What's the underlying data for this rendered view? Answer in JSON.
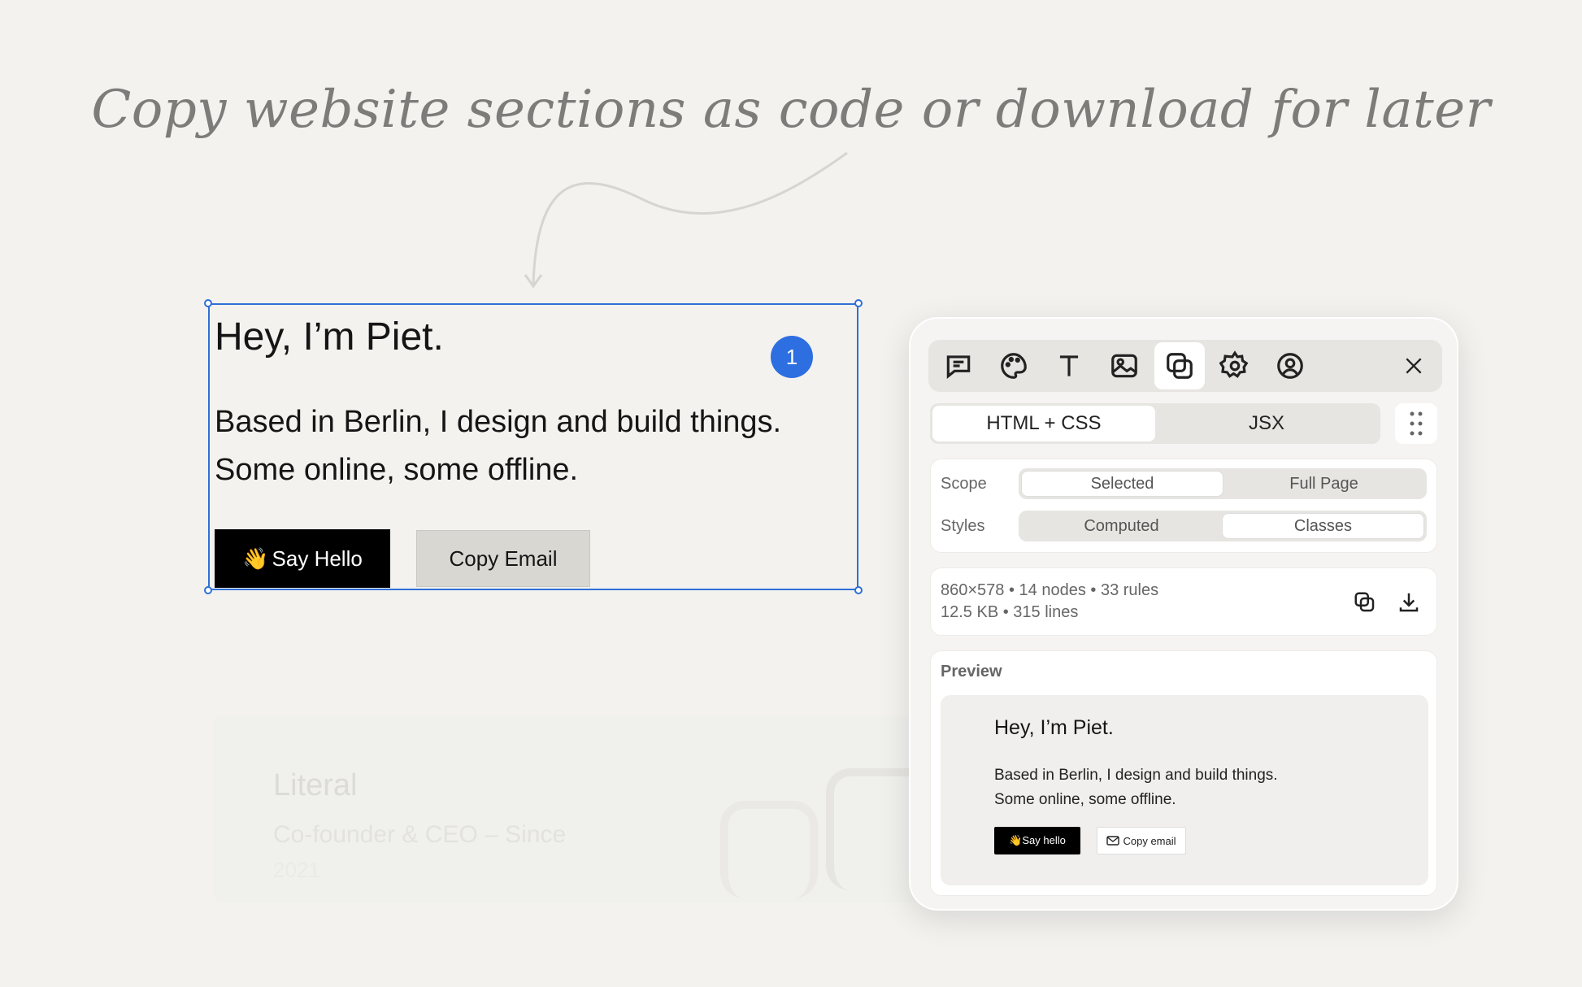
{
  "headline": "Copy website sections as code or download for later",
  "background_card": {
    "title": "Literal",
    "subtitle": "Co-founder & CEO – Since",
    "subtitle2": "2021"
  },
  "selection": {
    "badge": "1",
    "heading": "Hey, I’m Piet.",
    "bio_line1": "Based in Berlin, I design and build things.",
    "bio_line2": "Some online, some offline.",
    "hello_emoji": "👋",
    "hello_label": "Say Hello",
    "copy_label": "Copy Email"
  },
  "panel": {
    "toolbar": [
      "comment-icon",
      "palette-icon",
      "text-icon",
      "image-icon",
      "copy-icon",
      "gear-icon",
      "user-icon"
    ],
    "format_tabs": [
      "HTML + CSS",
      "JSX"
    ],
    "active_format": "HTML + CSS",
    "scope": {
      "label": "Scope",
      "options": [
        "Selected",
        "Full Page"
      ],
      "active": "Selected"
    },
    "styles": {
      "label": "Styles",
      "options": [
        "Computed",
        "Classes"
      ],
      "active": "Classes"
    },
    "meta_line1": "860×578 • 14 nodes • 33 rules",
    "meta_line2": "12.5 KB • 315 lines",
    "preview": {
      "label": "Preview",
      "heading": "Hey, I’m Piet.",
      "line1": "Based in Berlin, I design and build things.",
      "line2": "Some online, some offline.",
      "hello_label": "👋Say hello",
      "copy_label": "Copy email"
    }
  },
  "colors": {
    "accent": "#2f6fd8",
    "badge": "#2d6ee0",
    "background": "#f3f2ef"
  }
}
